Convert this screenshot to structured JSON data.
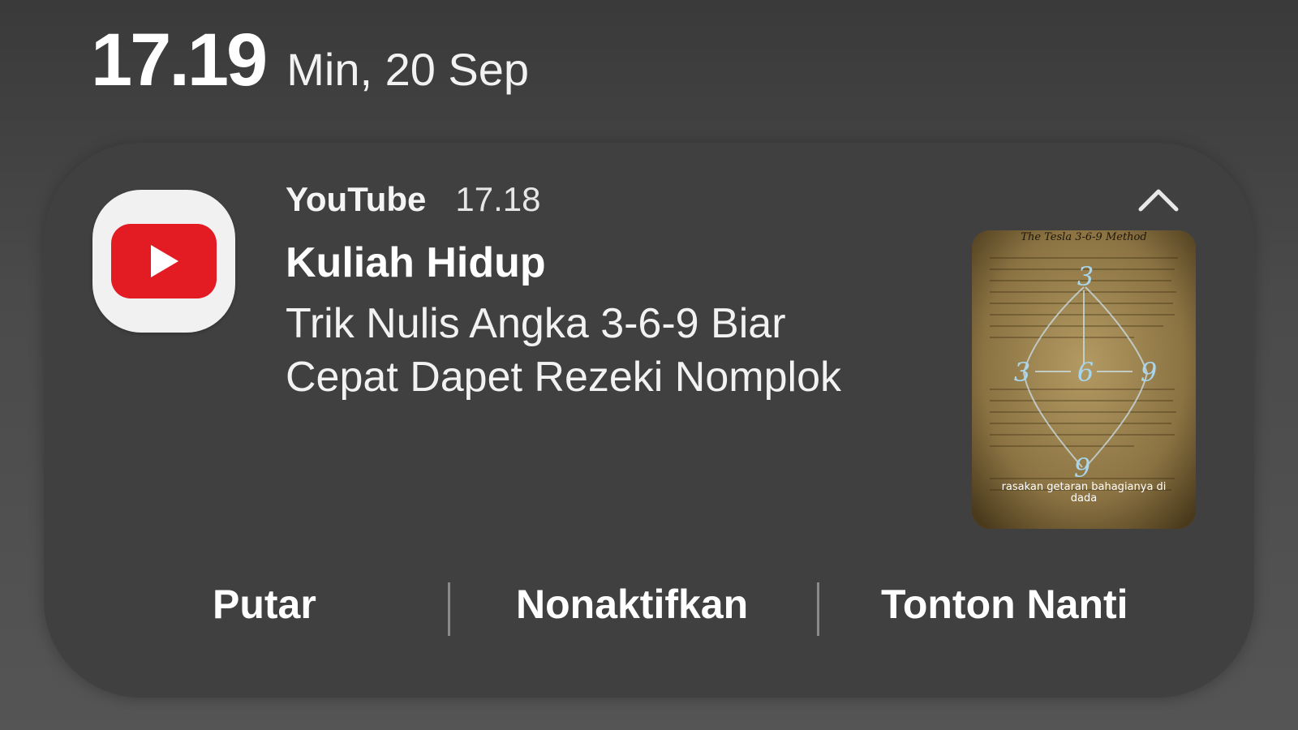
{
  "status_bar": {
    "time": "17.19",
    "date": "Min, 20 Sep"
  },
  "notification": {
    "app_name": "YouTube",
    "time": "17.18",
    "title": "Kuliah Hidup",
    "body_line1": "Trik Nulis Angka 3-6-9 Biar",
    "body_line2": "Cepat Dapet Rezeki Nomplok",
    "icon": "youtube-icon",
    "collapse_icon": "chevron-up-icon",
    "thumbnail": {
      "heading": "The Tesla 3-6-9 Method",
      "digits": [
        "3",
        "3",
        "6",
        "9",
        "9"
      ],
      "caption_line1": "rasakan getaran bahagianya di",
      "caption_line2": "dada"
    },
    "actions": [
      "Putar",
      "Nonaktifkan",
      "Tonton Nanti"
    ]
  },
  "colors": {
    "card_bg": "#404040",
    "youtube_red": "#e31b23",
    "page_bg": "#4a4a4a"
  }
}
